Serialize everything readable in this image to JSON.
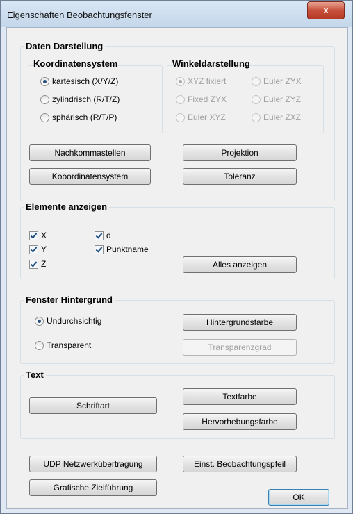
{
  "window": {
    "title": "Eigenschaften Beobachtungsfenster",
    "close_glyph": "x"
  },
  "daten": {
    "title": "Daten Darstellung",
    "koord": {
      "title": "Koordinatensystem",
      "options": [
        "kartesisch (X/Y/Z)",
        "zylindrisch (R/T/Z)",
        "sphärisch (R/T/P)"
      ],
      "selected": 0
    },
    "winkel": {
      "title": "Winkeldarstellung",
      "options": [
        "XYZ fixiert",
        "Euler ZYX",
        "Fixed ZYX",
        "Euler ZYZ",
        "Euler XYZ",
        "Euler ZXZ"
      ],
      "selected": 0,
      "enabled": false
    },
    "buttons": {
      "nachkomma": "Nachkommastellen",
      "projektion": "Projektion",
      "koordsys": "Kooordinatensystem",
      "toleranz": "Toleranz"
    }
  },
  "elemente": {
    "title": "Elemente anzeigen",
    "checks": [
      {
        "label": "X",
        "checked": true
      },
      {
        "label": "Y",
        "checked": true
      },
      {
        "label": "Z",
        "checked": true
      },
      {
        "label": "d",
        "checked": true
      },
      {
        "label": "Punktname",
        "checked": true
      }
    ],
    "alles_button": "Alles anzeigen"
  },
  "hintergrund": {
    "title": "Fenster Hintergrund",
    "options": [
      "Undurchsichtig",
      "Transparent"
    ],
    "selected": 0,
    "farbe_button": "Hintergrundsfarbe",
    "transparenz_button": "Transparenzgrad"
  },
  "text": {
    "title": "Text",
    "schriftart_button": "Schriftart",
    "textfarbe_button": "Textfarbe",
    "hervorhebung_button": "Hervorhebungsfarbe"
  },
  "bottom": {
    "udp_button": "UDP Netzwerkübertragung",
    "pfeil_button": "Einst. Beobachtungspfeil",
    "ziel_button": "Grafische Zielführung",
    "ok_button": "OK"
  }
}
